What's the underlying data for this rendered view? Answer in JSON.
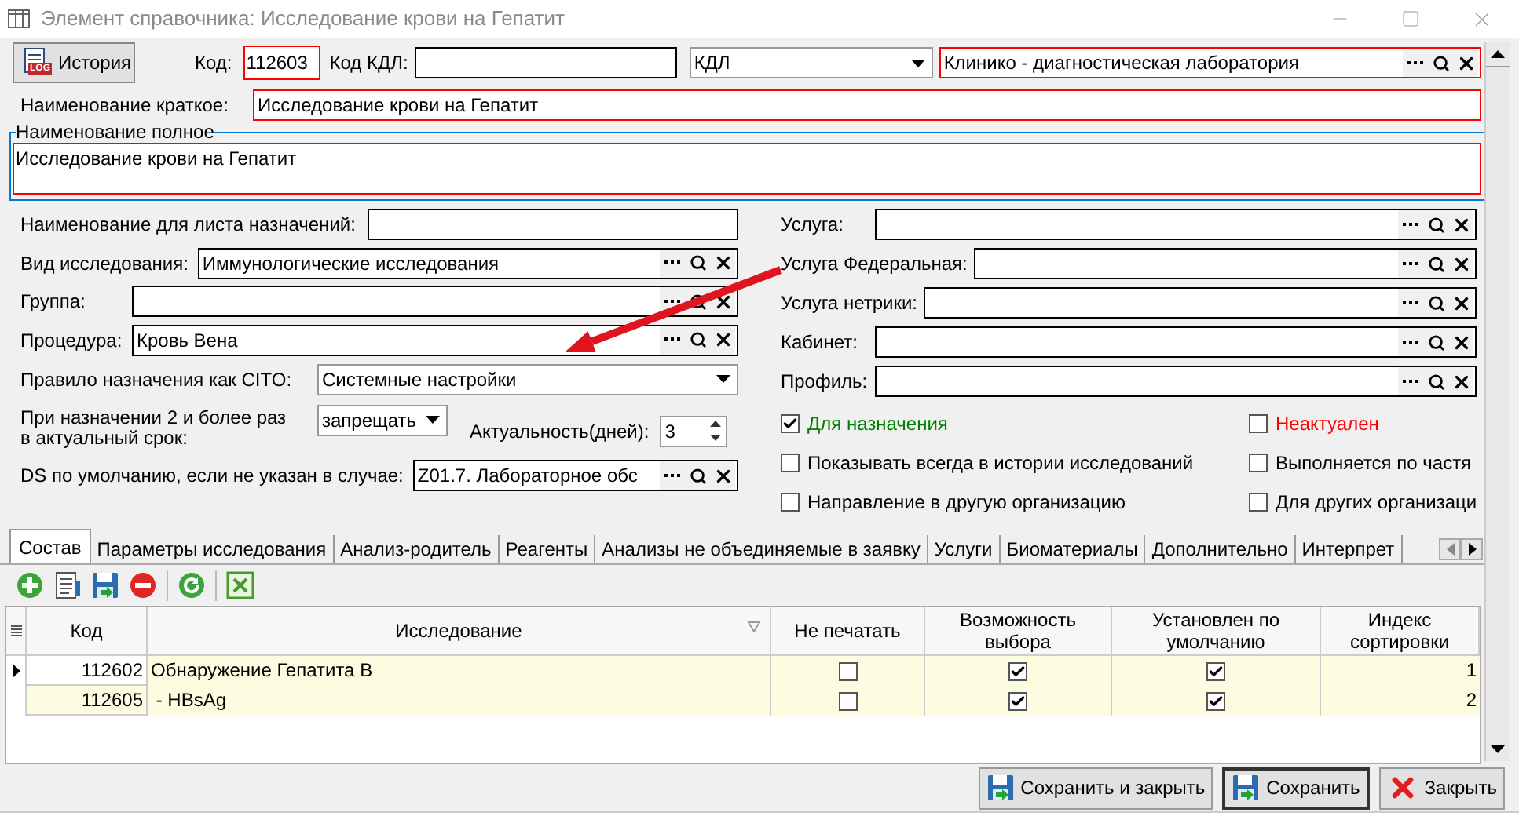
{
  "window": {
    "title": "Элемент справочника: Исследование крови на Гепатит"
  },
  "header": {
    "history_button": {
      "label": "История",
      "badge": "LOG"
    },
    "code_label": "Код:",
    "code": "112603",
    "kdl_label": "Код КДЛ:",
    "type_select": "КДЛ",
    "laboratory": "Клинико - диагностическая лаборатория"
  },
  "short_name": {
    "label": "Наименование краткое:",
    "value": "Исследование крови на Гепатит"
  },
  "full_name": {
    "legend": "Наименование полное",
    "value": "Исследование крови на Гепатит"
  },
  "left_fields": [
    {
      "kind": "text",
      "label": "Наименование для листа назначений:"
    },
    {
      "kind": "lookup",
      "label": "Вид исследования:",
      "value": "Иммунологические исследования"
    },
    {
      "kind": "lookup",
      "label": "Группа:"
    },
    {
      "kind": "lookup",
      "label": "Процедура:",
      "value": "Кровь Вена"
    },
    {
      "kind": "select",
      "label": "Правило назначения как CITO:",
      "value": "Системные настройки"
    },
    {
      "kind": "repeat",
      "label_lines": [
        "При назначении 2 и более раз",
        "в актуальный срок:"
      ],
      "value": "запрещать",
      "relevance_label": "Актуальность(дней):",
      "relevance_value": "3"
    },
    {
      "kind": "lookup",
      "label": "DS по умолчанию, если не указан в случае:",
      "value": "Z01.7. Лабораторное обс"
    }
  ],
  "right_fields": [
    {
      "label": "Услуга:"
    },
    {
      "label": "Услуга Федеральная:"
    },
    {
      "label": "Услуга нетрики:"
    },
    {
      "label": "Кабинет:"
    },
    {
      "label": "Профиль:"
    }
  ],
  "checkboxes": [
    {
      "label": "Для назначения",
      "checked": true,
      "color": "#008000"
    },
    {
      "label": "Неактуален",
      "checked": false,
      "color": "#ff0000"
    },
    {
      "label": "Показывать всегда в истории исследований",
      "checked": false
    },
    {
      "label": "Выполняется по частя",
      "checked": false
    },
    {
      "label": "Направление в другую организацию",
      "checked": false
    },
    {
      "label": "Для других организаци",
      "checked": false
    }
  ],
  "tabs": [
    {
      "label": "Состав",
      "selected": true
    },
    {
      "label": "Параметры исследования",
      "selected": false
    },
    {
      "label": "Анализ-родитель",
      "selected": false
    },
    {
      "label": "Реагенты",
      "selected": false
    },
    {
      "label": "Анализы не объединяемые в заявку",
      "selected": false
    },
    {
      "label": "Услуги",
      "selected": false
    },
    {
      "label": "Биоматериалы",
      "selected": false
    },
    {
      "label": "Дополнительно",
      "selected": false
    },
    {
      "label": "Интерпрет",
      "selected": false
    }
  ],
  "table": {
    "columns": [
      "Код",
      "Исследование",
      "Не печатать",
      "Возможность выбора",
      "Установлен по умолчанию",
      "Индекс сортировки"
    ],
    "rows": [
      {
        "current": true,
        "code": "112602",
        "name": "Обнаружение Гепатита В",
        "no_print": false,
        "choice": true,
        "default": true,
        "sort": "1"
      },
      {
        "current": false,
        "code": "112605",
        "name": " - HBsAg",
        "no_print": false,
        "choice": true,
        "default": true,
        "sort": "2"
      }
    ]
  },
  "buttons": [
    {
      "kind": "save_close",
      "label": "Сохранить и закрыть",
      "default": false
    },
    {
      "kind": "save",
      "label": "Сохранить",
      "default": true
    },
    {
      "kind": "close",
      "label": "Закрыть",
      "default": false
    }
  ]
}
